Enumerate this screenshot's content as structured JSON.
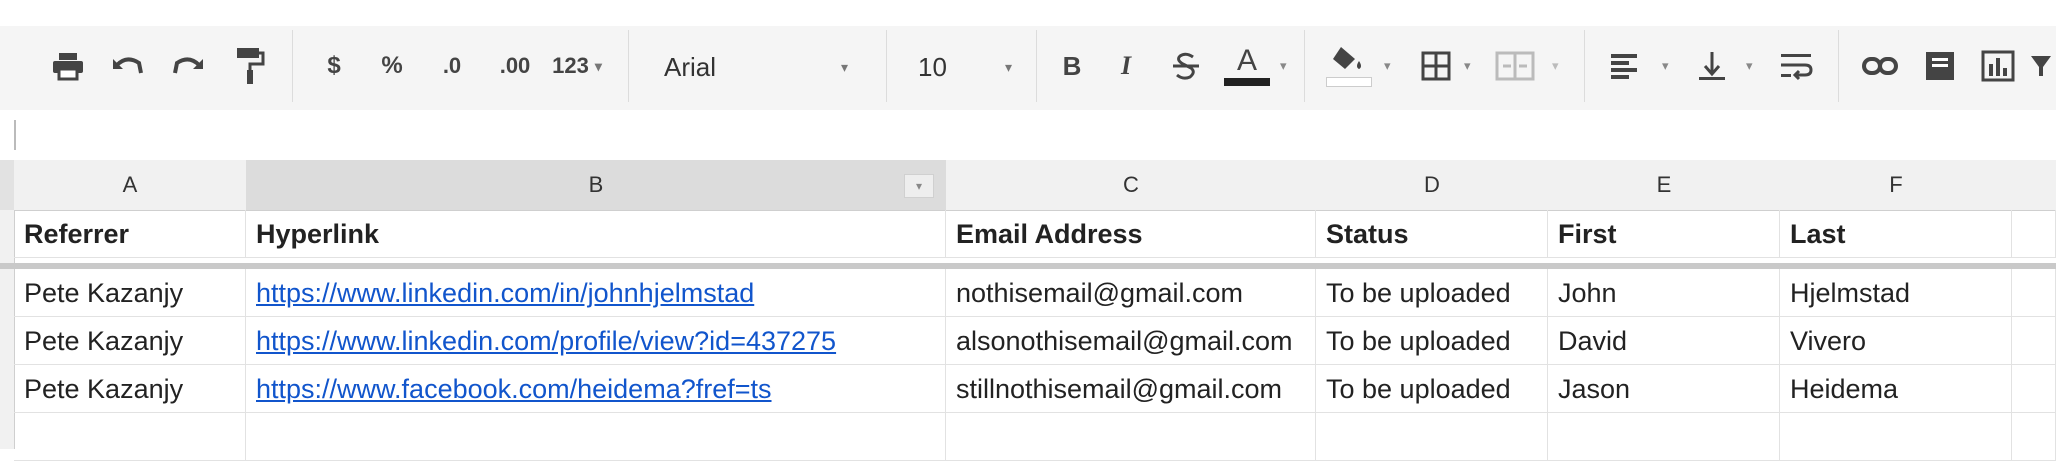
{
  "toolbar": {
    "currency_label": "$",
    "percent_label": "%",
    "decrease_decimal_label": ".0",
    "increase_decimal_label": ".00",
    "more_formats_label": "123",
    "font_name": "Arial",
    "font_size": "10",
    "bold_label": "B",
    "italic_label": "I",
    "text_color_label": "A"
  },
  "columns": [
    {
      "letter": "A"
    },
    {
      "letter": "B"
    },
    {
      "letter": "C"
    },
    {
      "letter": "D"
    },
    {
      "letter": "E"
    },
    {
      "letter": "F"
    }
  ],
  "header_row": [
    "Referrer",
    "Hyperlink",
    "Email Address",
    "Status",
    "First",
    "Last"
  ],
  "rows": [
    [
      "Pete Kazanjy",
      "https://www.linkedin.com/in/johnhjelmstad",
      "nothisemail@gmail.com",
      "To be uploaded",
      "John",
      "Hjelmstad"
    ],
    [
      "Pete Kazanjy",
      "https://www.linkedin.com/profile/view?id=437275",
      "alsonothisemail@gmail.com",
      "To be uploaded",
      "David",
      "Vivero"
    ],
    [
      "Pete Kazanjy",
      "https://www.facebook.com/heidema?fref=ts",
      "stillnothisemail@gmail.com",
      "To be uploaded",
      "Jason",
      "Heidema"
    ]
  ],
  "colors": {
    "link": "#1155cc",
    "toolbar_bg": "#f5f5f5",
    "header_bg": "#f1f1f1",
    "selected_header_bg": "#dcdcdc"
  },
  "icons": [
    "print-icon",
    "undo-icon",
    "redo-icon",
    "paint-format-icon",
    "bold-icon",
    "italic-icon",
    "strikethrough-icon",
    "text-color-icon",
    "fill-color-icon",
    "borders-icon",
    "merge-cells-icon",
    "align-left-icon",
    "valign-bottom-icon",
    "wrap-text-icon",
    "link-icon",
    "comment-icon",
    "chart-icon",
    "filter-icon"
  ]
}
